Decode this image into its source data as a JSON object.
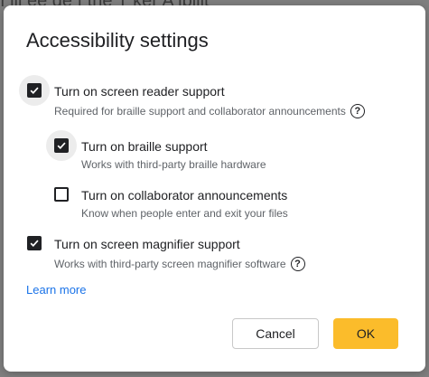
{
  "backdrop_text": "I ill ee de f the T  ker A  ibilit",
  "dialog": {
    "title": "Accessibility settings",
    "options": [
      {
        "label": "Turn on screen reader support",
        "description": "Required for braille support and collaborator announcements",
        "checked": true,
        "help_icon": "help-circle-icon"
      },
      {
        "label": "Turn on braille support",
        "description": "Works with third-party braille hardware",
        "checked": true
      },
      {
        "label": "Turn on collaborator announcements",
        "description": "Know when people enter and exit your files",
        "checked": false
      },
      {
        "label": "Turn on screen magnifier support",
        "description": "Works with third-party screen magnifier software",
        "checked": true,
        "help_icon": "help-circle-icon"
      }
    ],
    "learn_more": "Learn more",
    "buttons": {
      "cancel": "Cancel",
      "ok": "OK"
    },
    "colors": {
      "ok_button": "#fbbc2b",
      "link": "#1a73e8",
      "checkbox": "#202124"
    }
  }
}
